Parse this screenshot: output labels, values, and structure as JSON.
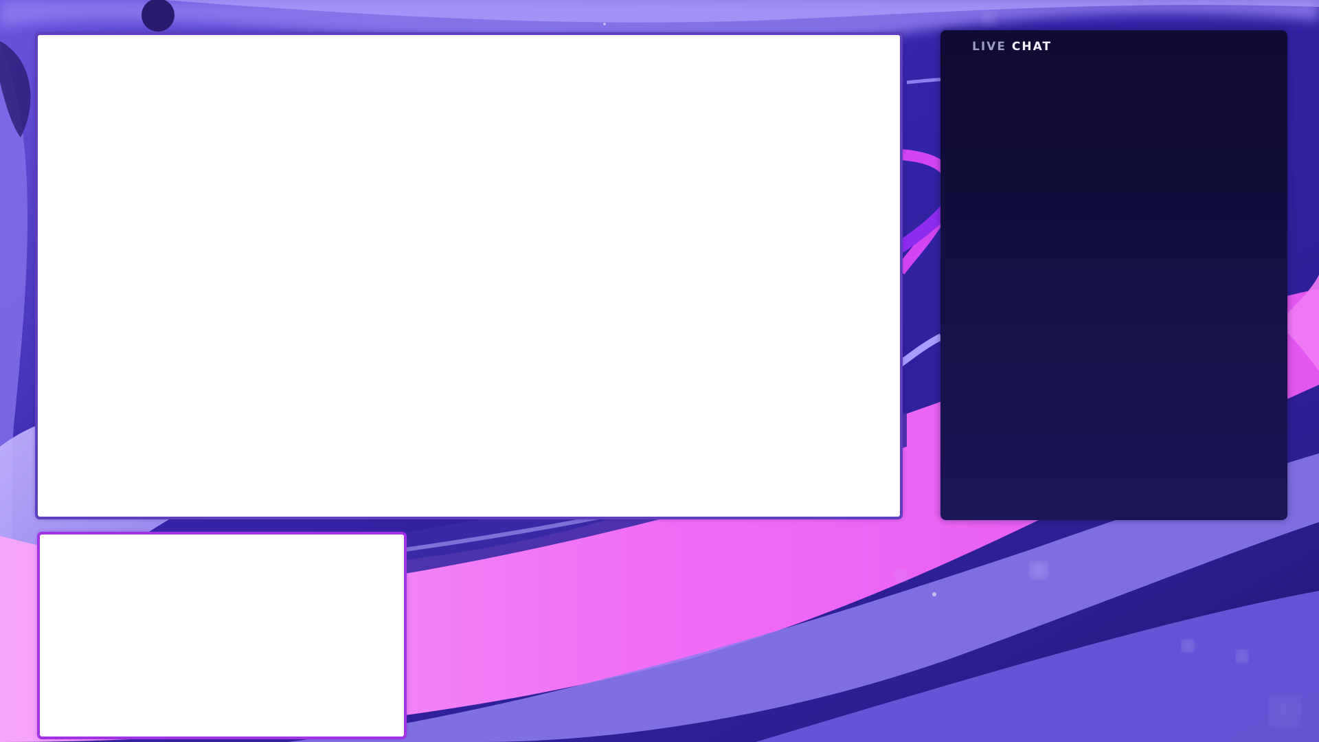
{
  "chat": {
    "title_part1": "LIVE",
    "title_part2": "CHAT"
  },
  "colors": {
    "main_frame_border": "#5d3fbf",
    "webcam_frame_border": "#a132e6",
    "chat_panel_top": "#0f0b33",
    "chat_panel_bottom": "#1b1656",
    "background_primary": "#3b2bb0",
    "background_accent": "#f06cf5"
  }
}
